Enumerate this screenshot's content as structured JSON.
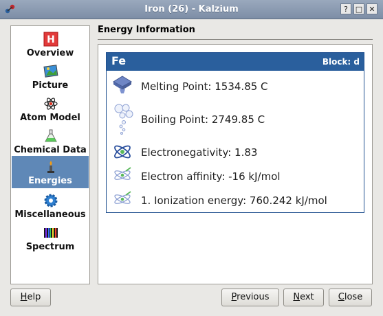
{
  "window": {
    "title": "Iron (26) - Kalzium",
    "buttons": {
      "help": "?",
      "minimize": "□",
      "close": "✕"
    }
  },
  "nav": {
    "items": [
      {
        "label": "Overview",
        "icon": "overview-icon"
      },
      {
        "label": "Picture",
        "icon": "picture-icon"
      },
      {
        "label": "Atom Model",
        "icon": "atom-model-icon"
      },
      {
        "label": "Chemical Data",
        "icon": "flask-icon"
      },
      {
        "label": "Energies",
        "icon": "bunsen-burner-icon",
        "selected": true
      },
      {
        "label": "Miscellaneous",
        "icon": "gear-icon"
      },
      {
        "label": "Spectrum",
        "icon": "spectrum-icon"
      }
    ]
  },
  "page": {
    "title": "Energy Information",
    "element": {
      "symbol": "Fe",
      "block": "Block: d"
    },
    "rows": [
      {
        "text": "Melting Point: 1534.85 C",
        "icon": "melting-point-icon"
      },
      {
        "text": "Boiling Point: 2749.85 C",
        "icon": "boiling-point-icon"
      },
      {
        "text": "Electronegativity: 1.83",
        "icon": "electronegativity-icon"
      },
      {
        "text": "Electron affinity: -16 kJ/mol",
        "icon": "electron-affinity-icon"
      },
      {
        "text": "1. Ionization energy: 760.242 kJ/mol",
        "icon": "ionization-energy-icon"
      }
    ]
  },
  "footer": {
    "help": {
      "mnemonic": "H",
      "rest": "elp"
    },
    "previous": {
      "mnemonic": "P",
      "rest": "revious"
    },
    "next": {
      "mnemonic": "N",
      "rest": "ext"
    },
    "close": {
      "mnemonic": "C",
      "rest": "lose"
    }
  },
  "colors": {
    "selection": "#5f88b7",
    "header": "#2a5f9d",
    "titlebar": "#8a9ab0"
  }
}
